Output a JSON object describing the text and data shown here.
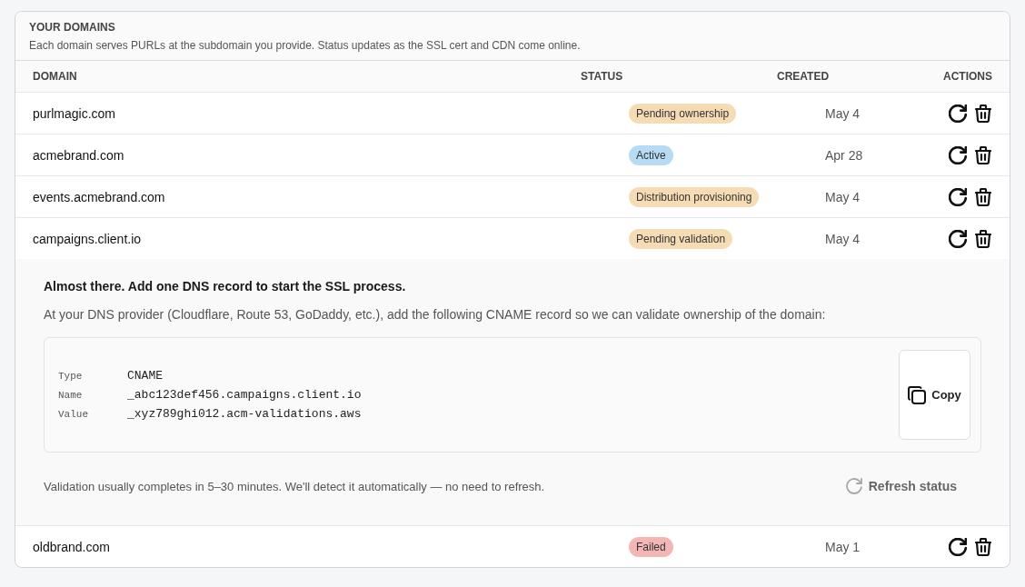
{
  "section": {
    "title": "YOUR DOMAINS",
    "description": "Each domain serves PURLs at the subdomain you provide. Status updates as the SSL cert and CDN come online."
  },
  "table": {
    "columns": [
      "DOMAIN",
      "STATUS",
      "CREATED",
      "ACTIONS"
    ],
    "rows": [
      {
        "domain": "purlmagic.com",
        "status": {
          "label": "Pending ownership",
          "color": "#f6dcb5"
        },
        "created": "May 4"
      },
      {
        "domain": "acmebrand.com",
        "status": {
          "label": "Active",
          "color": "#b7dbf4"
        },
        "created": "Apr 28"
      },
      {
        "domain": "events.acmebrand.com",
        "status": {
          "label": "Distribution provisioning",
          "color": "#f6dcb5"
        },
        "created": "May 4"
      },
      {
        "domain": "campaigns.client.io",
        "status": {
          "label": "Pending validation",
          "color": "#f6dcb5"
        },
        "created": "May 4",
        "details": {
          "heading": "Almost there. Add one DNS record to start the SSL process.",
          "instructions": "At your DNS provider (Cloudflare, Route 53, GoDaddy, etc.), add the following CNAME record so we can validate ownership of the domain:",
          "record": [
            {
              "label": "Type",
              "value": "CNAME"
            },
            {
              "label": "Name",
              "value": "_abc123def456.campaigns.client.io"
            },
            {
              "label": "Value",
              "value": "_xyz789ghi012.acm-validations.aws"
            }
          ],
          "copy_button": "Copy",
          "note": "Validation usually completes in 5–30 minutes. We'll detect it automatically — no need to refresh.",
          "refresh_button": "Refresh status"
        }
      },
      {
        "domain": "oldbrand.com",
        "status": {
          "label": "Failed",
          "color": "#f4b5b5"
        },
        "created": "May 1"
      }
    ]
  }
}
